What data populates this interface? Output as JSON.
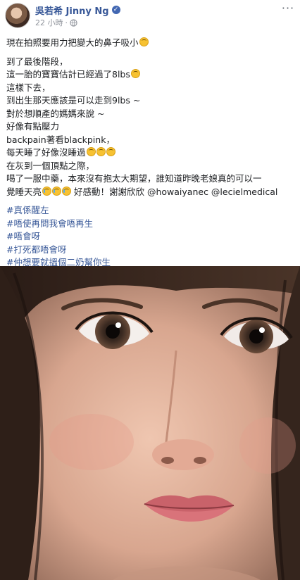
{
  "post": {
    "author": "吳若希 Jinny Ng",
    "time": "22 小時",
    "separator": "·",
    "more": "···"
  },
  "text": {
    "lead": "現在拍照要用力把變大的鼻子吸小",
    "block1": [
      "到了最後階段，",
      "這一胎的寶寶估計已經過了8lbs",
      "這樣下去，",
      "到出生那天應該是可以走到9lbs ~",
      "對於想順產的媽媽來說 ~",
      "好像有點壓力",
      "backpain著看blackpink，",
      "每天睡了好像沒睡過",
      "在灰到一個頂點之際，",
      "喝了一服中藥，本來沒有抱太大期望，誰知道昨晚老娘真的可以一",
      "覺睡天亮"
    ],
    "thanks": "好感動！謝謝欣欣 @howaiyanec @lecielmedical",
    "hashtags": [
      "#真係醒左",
      "#唔使再問我會唔再生",
      "#唔會呀",
      "#打死都唔會呀",
      "#仲想要就搵個二奶幫你生"
    ]
  },
  "colors": {
    "link": "#385898",
    "meta": "#90949c",
    "text": "#1c1e21"
  },
  "icons": {
    "verified": "verified-badge-icon",
    "audience": "globe-icon",
    "emoji": "emoji-icon"
  }
}
